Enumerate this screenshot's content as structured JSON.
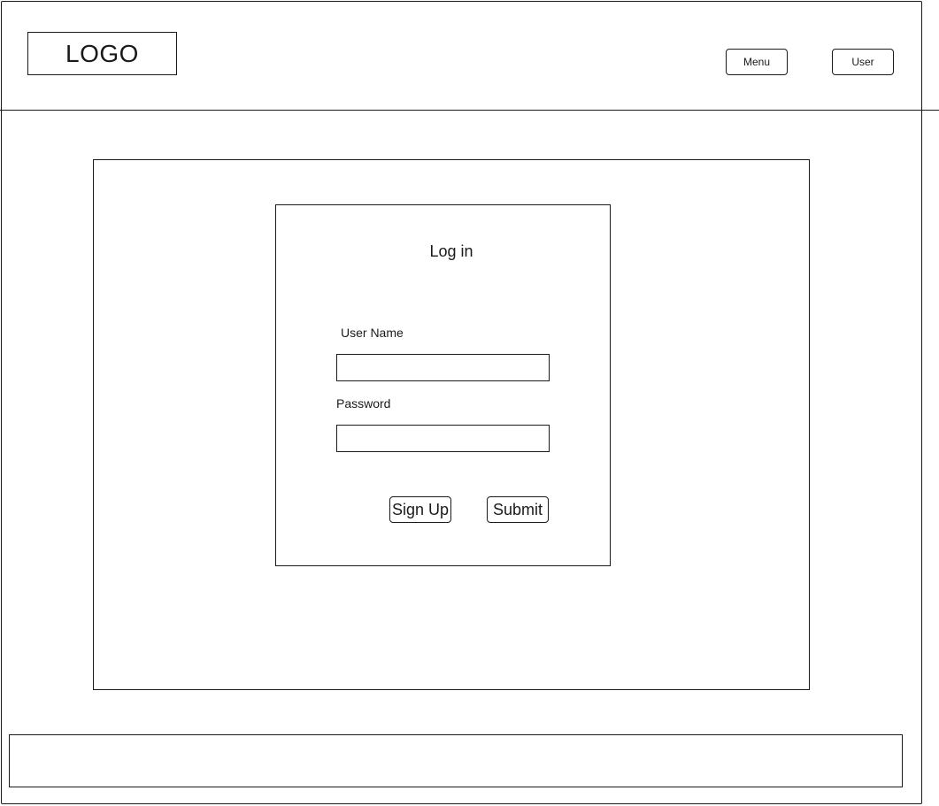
{
  "header": {
    "logo_text": "LOGO",
    "menu_label": "Menu",
    "user_label": "User"
  },
  "login": {
    "title": "Log in",
    "username_label": "User Name",
    "username_value": "",
    "password_label": "Password",
    "password_value": "",
    "signup_label": "Sign Up",
    "submit_label": "Submit"
  },
  "footer": {
    "text": ""
  }
}
